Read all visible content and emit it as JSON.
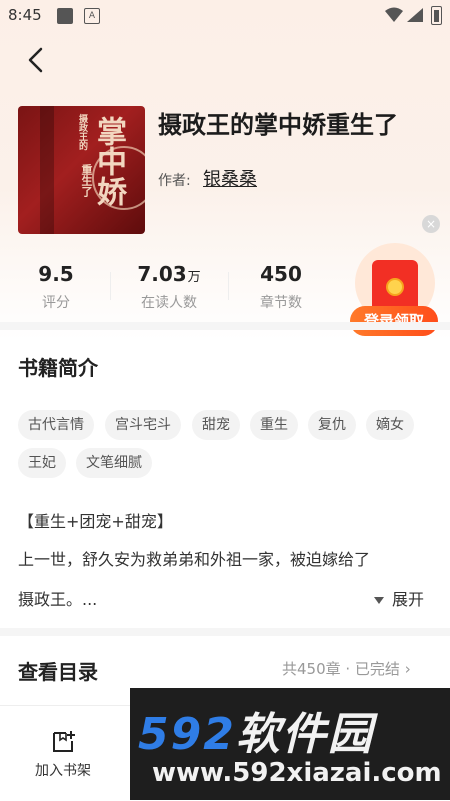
{
  "status_bar": {
    "time": "8:45",
    "notif_icon": "A"
  },
  "book": {
    "title": "摄政王的掌中娇重生了",
    "author_label": "作者:",
    "author": "银桑桑",
    "cover_text": {
      "main": "掌中娇",
      "sub1": "摄政王的",
      "sub2": "重生了"
    }
  },
  "stats": [
    {
      "value": "9.5",
      "unit": "",
      "label": "评分"
    },
    {
      "value": "7.03",
      "unit": "万",
      "label": "在读人数"
    },
    {
      "value": "450",
      "unit": "",
      "label": "章节数"
    }
  ],
  "promo": {
    "button": "登录领取",
    "close": "×"
  },
  "intro": {
    "title": "书籍简介",
    "tags": [
      "古代言情",
      "宫斗宅斗",
      "甜宠",
      "重生",
      "复仇",
      "嫡女",
      "王妃",
      "文笔细腻"
    ],
    "lines": [
      "【重生+团宠+甜宠】",
      "上一世，舒久安为救弟弟和外祖一家，被迫嫁给了",
      "摄政王。..."
    ],
    "expand": "展开"
  },
  "catalog": {
    "title": "查看目录",
    "info": "共450章 · 已完结 ›"
  },
  "bottom": {
    "shelf": "加入书架"
  },
  "watermark": {
    "num": "592",
    "cn": "软件园",
    "url": "www.592xiazai.com"
  },
  "colors": {
    "accent": "#ff5a1f",
    "cover_red": "#a21f1f"
  }
}
